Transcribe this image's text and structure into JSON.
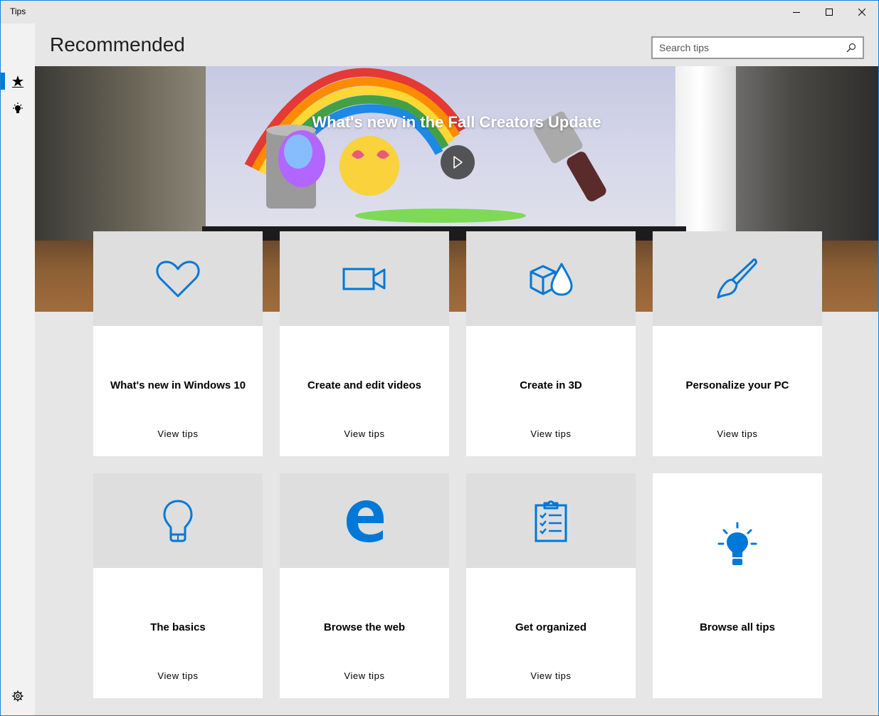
{
  "window": {
    "title": "Tips"
  },
  "header": {
    "title": "Recommended"
  },
  "search": {
    "placeholder": "Search tips"
  },
  "hero": {
    "title": "What's new in the Fall Creators Update"
  },
  "accent_color": "#0078d7",
  "tiles": [
    {
      "title": "What's new in Windows 10",
      "link": "View tips",
      "icon": "heart-icon"
    },
    {
      "title": "Create and edit videos",
      "link": "View tips",
      "icon": "video-camera-icon"
    },
    {
      "title": "Create in 3D",
      "link": "View tips",
      "icon": "3d-shapes-icon"
    },
    {
      "title": "Personalize your PC",
      "link": "View tips",
      "icon": "paintbrush-icon"
    },
    {
      "title": "The basics",
      "link": "View tips",
      "icon": "lightbulb-icon"
    },
    {
      "title": "Browse the web",
      "link": "View tips",
      "icon": "edge-icon"
    },
    {
      "title": "Get organized",
      "link": "View tips",
      "icon": "clipboard-icon"
    },
    {
      "title": "Browse all tips",
      "link": "",
      "icon": "glowing-lightbulb-icon"
    }
  ]
}
